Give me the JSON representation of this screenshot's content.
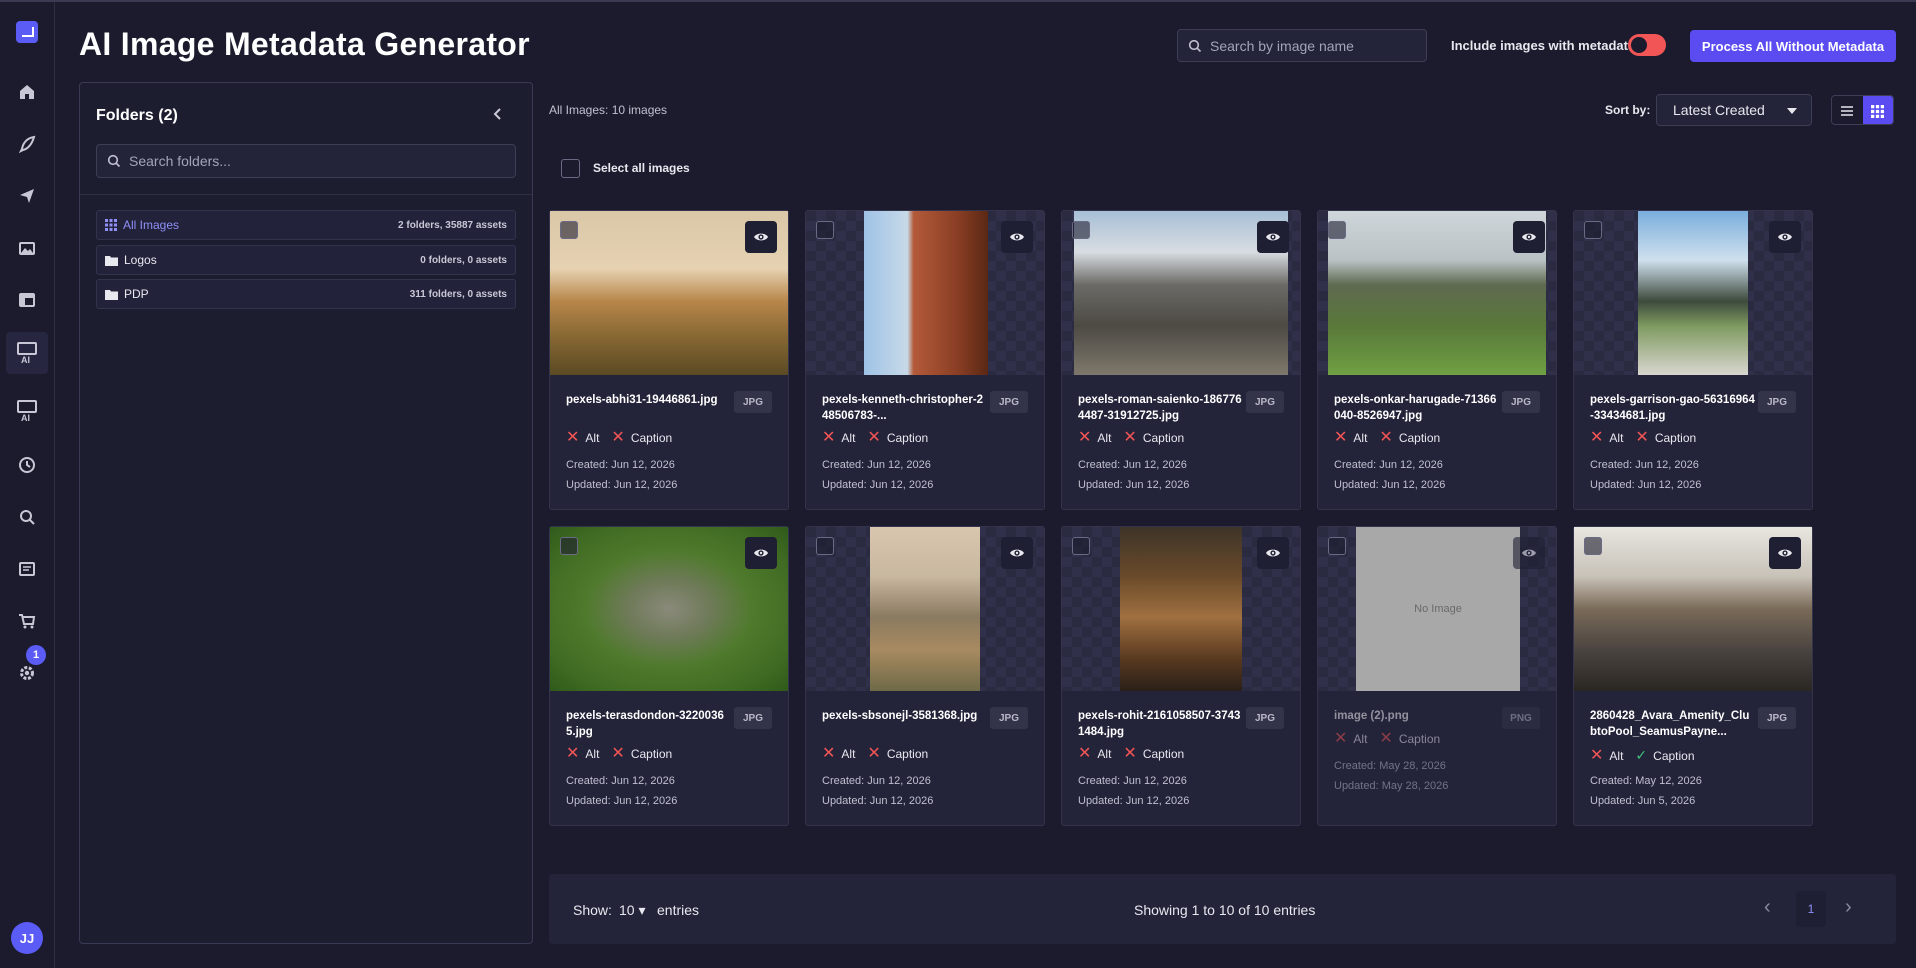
{
  "app": {
    "title": "AI Image Metadata Generator"
  },
  "header": {
    "search_placeholder": "Search by image name",
    "include_label": "Include images with metadata",
    "process_button": "Process All Without Metadata"
  },
  "rail": {
    "badge_count": "1",
    "ai_label": "AI",
    "avatar": "JJ"
  },
  "folders": {
    "title": "Folders (2)",
    "search_placeholder": "Search folders...",
    "items": [
      {
        "name": "All Images",
        "count": "2 folders, 35887 assets"
      },
      {
        "name": "Logos",
        "count": "0 folders, 0 assets"
      },
      {
        "name": "PDP",
        "count": "311 folders, 0 assets"
      }
    ]
  },
  "main": {
    "all_images_label": "All Images: 10 images",
    "sort_label": "Sort by:",
    "sort_value": "Latest Created",
    "select_all": "Select all images",
    "alt_label": "Alt",
    "caption_label": "Caption",
    "no_image": "No Image",
    "cards": [
      {
        "name": "pexels-abhi31-19446861.jpg",
        "ext": "JPG",
        "created": "Created: Jun 12, 2026",
        "updated": "Updated: Jun 12, 2026"
      },
      {
        "name": "pexels-kenneth-christopher-248506783-...",
        "ext": "JPG",
        "created": "Created: Jun 12, 2026",
        "updated": "Updated: Jun 12, 2026"
      },
      {
        "name": "pexels-roman-saienko-1867764487-31912725.jpg",
        "ext": "JPG",
        "created": "Created: Jun 12, 2026",
        "updated": "Updated: Jun 12, 2026"
      },
      {
        "name": "pexels-onkar-harugade-71366040-8526947.jpg",
        "ext": "JPG",
        "created": "Created: Jun 12, 2026",
        "updated": "Updated: Jun 12, 2026"
      },
      {
        "name": "pexels-garrison-gao-56316964-33434681.jpg",
        "ext": "JPG",
        "created": "Created: Jun 12, 2026",
        "updated": "Updated: Jun 12, 2026"
      },
      {
        "name": "pexels-terasdondon-32200365.jpg",
        "ext": "JPG",
        "created": "Created: Jun 12, 2026",
        "updated": "Updated: Jun 12, 2026"
      },
      {
        "name": "pexels-sbsonejl-3581368.jpg",
        "ext": "JPG",
        "created": "Created: Jun 12, 2026",
        "updated": "Updated: Jun 12, 2026"
      },
      {
        "name": "pexels-rohit-2161058507-37431484.jpg",
        "ext": "JPG",
        "created": "Created: Jun 12, 2026",
        "updated": "Updated: Jun 12, 2026"
      },
      {
        "name": "image (2).png",
        "ext": "PNG",
        "created": "Created: May 28, 2026",
        "updated": "Updated: May 28, 2026"
      },
      {
        "name": "2860428_Avara_Amenity_ClubtoPool_SeamusPayne...",
        "ext": "JPG",
        "created": "Created: May 12, 2026",
        "updated": "Updated: Jun 5, 2026"
      }
    ]
  },
  "footer": {
    "show_label": "Show:",
    "show_value": "10",
    "entries_label": "entries",
    "showing": "Showing 1 to 10 of 10 entries",
    "page": "1"
  },
  "colors": {
    "accent": "#5b4cf2",
    "background": "#1b1b2d",
    "missing": "#f25555",
    "present": "#3fc27a"
  }
}
